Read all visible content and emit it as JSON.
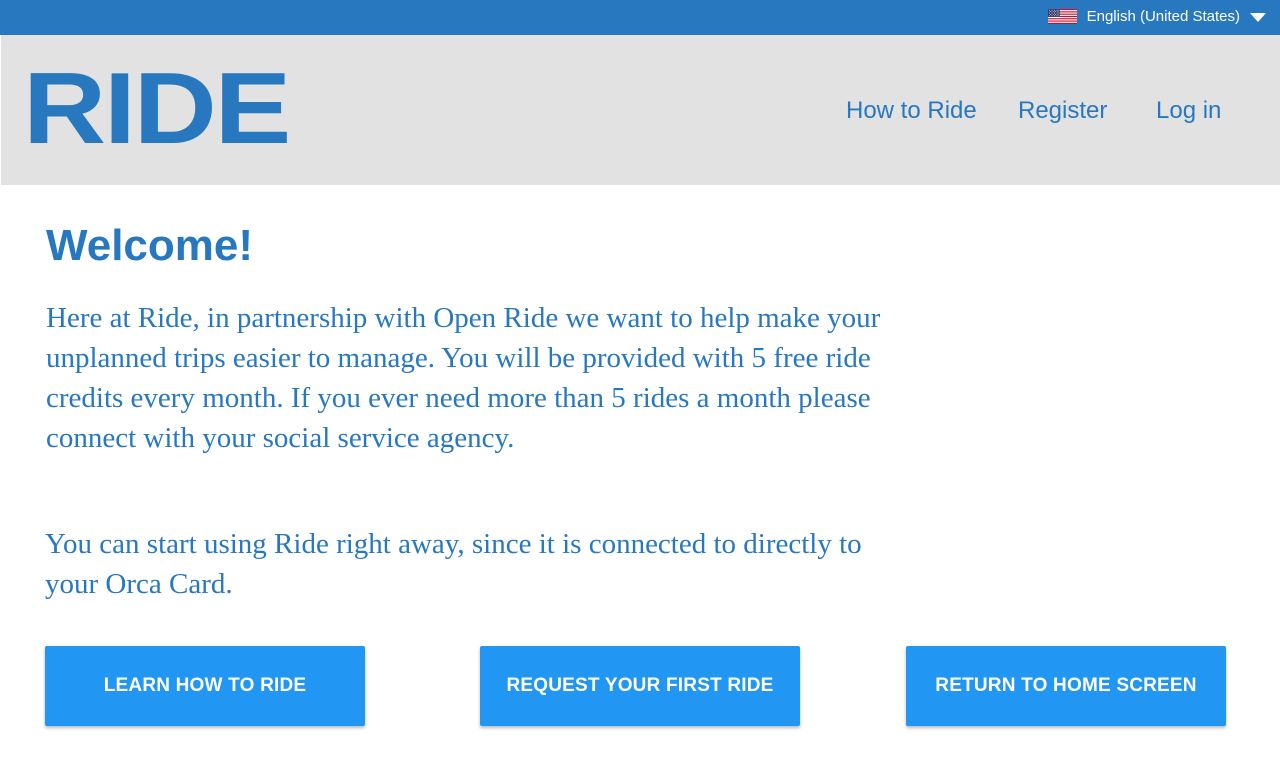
{
  "language_bar": {
    "flag_icon": "us-flag-icon",
    "selected_language": "English (United States)",
    "dropdown_icon": "caret-down-icon",
    "background_color": "#2878c0"
  },
  "header": {
    "logo_text": "RIDE",
    "nav": {
      "how_to_ride": "How to Ride",
      "register": "Register",
      "log_in": "Log in"
    },
    "background_color": "#e2e2e2"
  },
  "main": {
    "title": "Welcome!",
    "paragraph_1": "Here at Ride, in partnership with Open Ride we want to help make your unplanned trips easier to manage. You will be provided with 5 free ride credits every month. If you ever need more than 5 rides a month please connect with your social service agency.",
    "paragraph_2": "You can start using Ride right away, since it is connected to directly to your Orca Card.",
    "text_color": "#2878c0"
  },
  "buttons": {
    "learn_how": "LEARN HOW TO RIDE",
    "request_first": "REQUEST YOUR FIRST RIDE",
    "return_home": "RETURN TO HOME SCREEN",
    "color": "#2196f3"
  }
}
